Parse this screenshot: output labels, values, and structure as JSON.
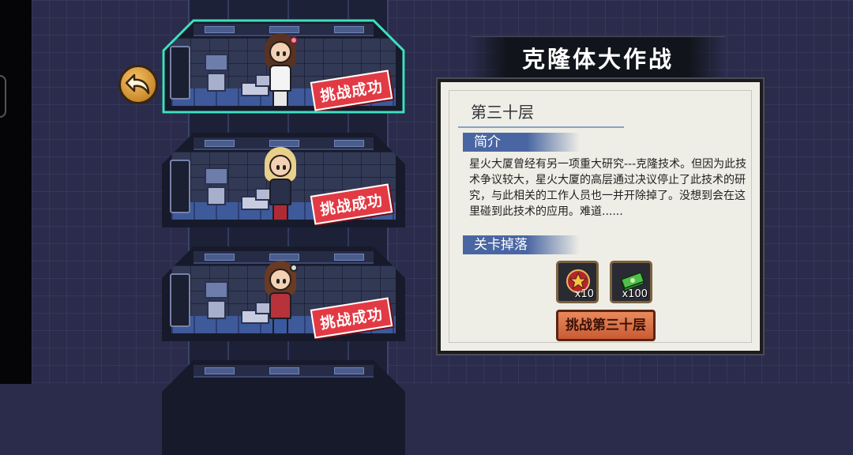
{
  "game": {
    "title": "克隆体大作战",
    "back_icon": "curved-arrow-left-icon"
  },
  "floors": [
    {
      "status": "挑战成功",
      "character": "brown-hair-girl",
      "selected": true
    },
    {
      "status": "挑战成功",
      "character": "blonde-girl",
      "selected": false
    },
    {
      "status": "挑战成功",
      "character": "headphone-girl",
      "selected": false
    }
  ],
  "panel": {
    "floor_name": "第三十层",
    "intro_label": "简介",
    "intro_text": "星火大厦曾经有另一项重大研究---克隆技术。但因为此技术争议较大，星火大厦的高层通过决议停止了此技术的研究，与此相关的工作人员也一并开除掉了。没想到会在这里碰到此技术的应用。难道......",
    "drops_label": "关卡掉落",
    "drops": [
      {
        "icon": "medal-star-icon",
        "qty": "x10"
      },
      {
        "icon": "cash-stack-icon",
        "qty": "x100"
      }
    ],
    "challenge_button": "挑战第三十层"
  },
  "colors": {
    "stamp": "#e23a44",
    "selected_glow": "#3fe0c0",
    "button": "#d9714a"
  }
}
